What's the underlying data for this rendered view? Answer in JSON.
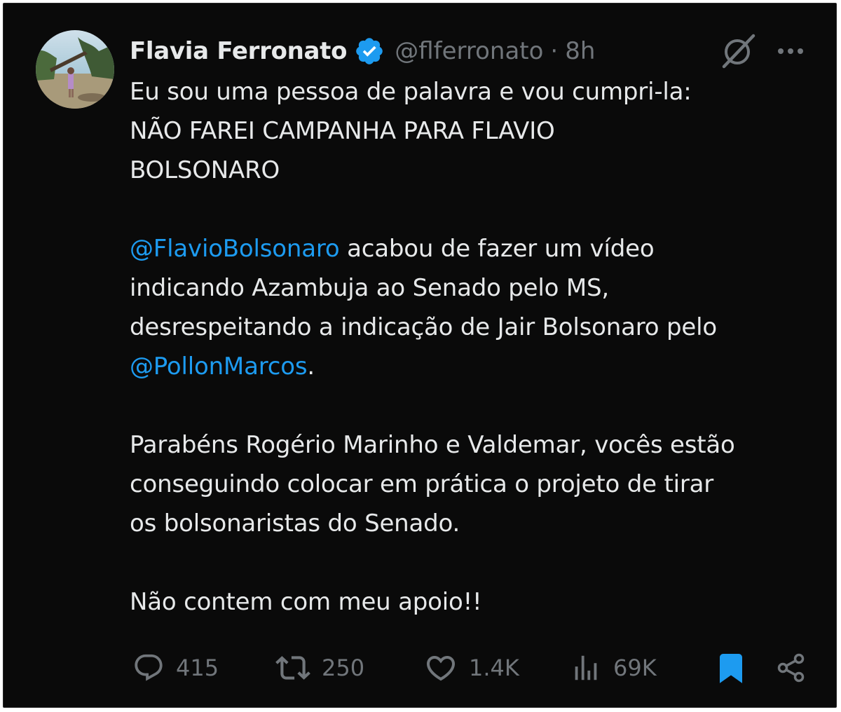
{
  "tweet": {
    "author_name": "Flavia Ferronato",
    "handle": "@flferronato",
    "separator": "·",
    "time": "8h",
    "paragraphs": [
      {
        "lines": [
          "Eu sou uma pessoa de palavra e vou cumpri-la:",
          "NÃO FAREI CAMPANHA PARA FLAVIO",
          "BOLSONARO"
        ]
      },
      {
        "mention1": "@FlavioBolsonaro",
        "text1": " acabou de fazer um vídeo",
        "line2": "indicando Azambuja ao Senado pelo MS,",
        "line3": "desrespeitando a indicação de Jair Bolsonaro pelo",
        "mention2": "@PollonMarcos",
        "text2": "."
      },
      {
        "lines": [
          "Parabéns Rogério Marinho e Valdemar, vocês estão",
          "conseguindo colocar em prática o projeto de tirar",
          "os bolsonaristas do Senado."
        ]
      },
      {
        "lines": [
          "Não contem com meu apoio!!"
        ]
      }
    ]
  },
  "actions": {
    "replies": "415",
    "reposts": "250",
    "likes": "1.4K",
    "views": "69K"
  },
  "icons": {
    "verified": "verified-badge-icon",
    "grok": "grok-icon",
    "more": "more-icon",
    "reply": "reply-icon",
    "repost": "repost-icon",
    "like": "heart-icon",
    "views": "views-icon",
    "bookmark": "bookmark-icon",
    "share": "share-icon"
  },
  "colors": {
    "background": "#0a0a0a",
    "text": "#e7e9ea",
    "muted": "#71767b",
    "accent": "#1d9bf0"
  }
}
